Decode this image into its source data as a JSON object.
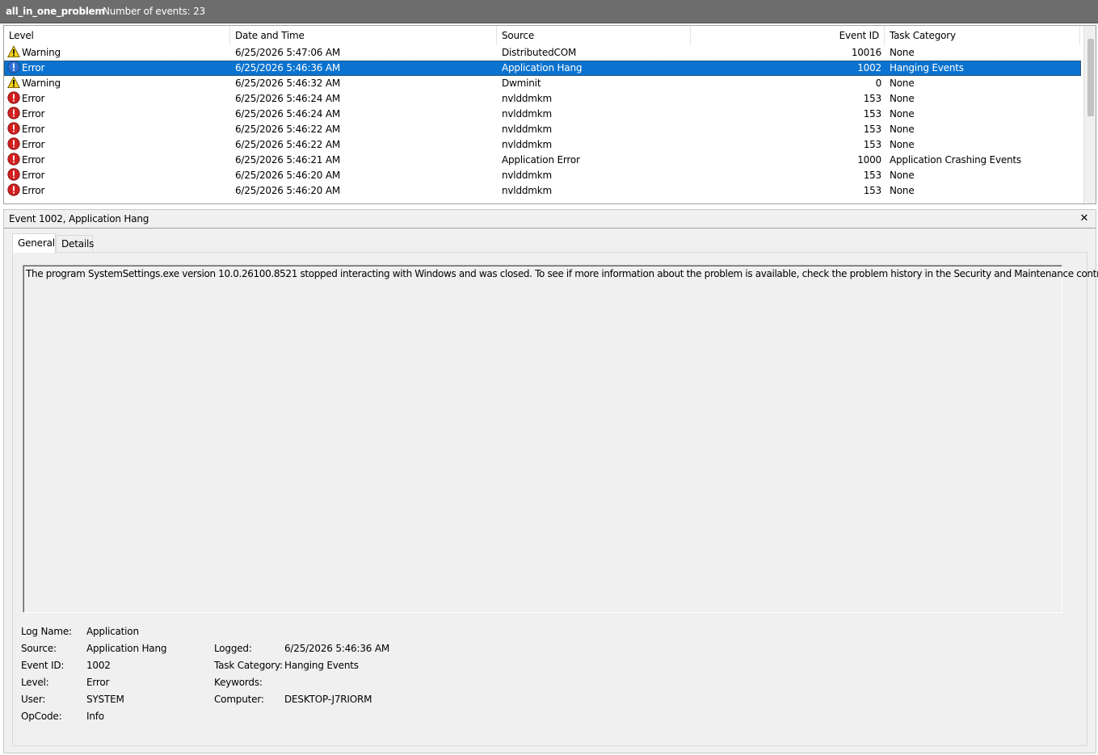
{
  "header": {
    "title": "all_in_one_problem",
    "count": "Number of events: 23"
  },
  "columns": {
    "level": "Level",
    "date_time": "Date and Time",
    "source": "Source",
    "event_id": "Event ID",
    "task_category": "Task Category"
  },
  "rows": [
    {
      "level": "Warning",
      "icon": "warning-icon",
      "date_time": "6/25/2026 5:47:06 AM",
      "source": "DistributedCOM",
      "event_id": "10016",
      "task_category": "None",
      "selected": false
    },
    {
      "level": "Error",
      "icon": "error-icon",
      "date_time": "6/25/2026 5:46:36 AM",
      "source": "Application Hang",
      "event_id": "1002",
      "task_category": "Hanging Events",
      "selected": true
    },
    {
      "level": "Warning",
      "icon": "warning-icon",
      "date_time": "6/25/2026 5:46:32 AM",
      "source": "Dwminit",
      "event_id": "0",
      "task_category": "None",
      "selected": false
    },
    {
      "level": "Error",
      "icon": "error-icon",
      "date_time": "6/25/2026 5:46:24 AM",
      "source": "nvlddmkm",
      "event_id": "153",
      "task_category": "None",
      "selected": false
    },
    {
      "level": "Error",
      "icon": "error-icon",
      "date_time": "6/25/2026 5:46:24 AM",
      "source": "nvlddmkm",
      "event_id": "153",
      "task_category": "None",
      "selected": false
    },
    {
      "level": "Error",
      "icon": "error-icon",
      "date_time": "6/25/2026 5:46:22 AM",
      "source": "nvlddmkm",
      "event_id": "153",
      "task_category": "None",
      "selected": false
    },
    {
      "level": "Error",
      "icon": "error-icon",
      "date_time": "6/25/2026 5:46:22 AM",
      "source": "nvlddmkm",
      "event_id": "153",
      "task_category": "None",
      "selected": false
    },
    {
      "level": "Error",
      "icon": "error-icon",
      "date_time": "6/25/2026 5:46:21 AM",
      "source": "Application Error",
      "event_id": "1000",
      "task_category": "Application Crashing Events",
      "selected": false
    },
    {
      "level": "Error",
      "icon": "error-icon",
      "date_time": "6/25/2026 5:46:20 AM",
      "source": "nvlddmkm",
      "event_id": "153",
      "task_category": "None",
      "selected": false
    },
    {
      "level": "Error",
      "icon": "error-icon",
      "date_time": "6/25/2026 5:46:20 AM",
      "source": "nvlddmkm",
      "event_id": "153",
      "task_category": "None",
      "selected": false
    }
  ],
  "detail": {
    "title": "Event 1002, Application Hang",
    "close_icon": "close-icon",
    "tabs": [
      "General",
      "Details"
    ],
    "active_tab": "General",
    "description": "The program SystemSettings.exe version 10.0.26100.8521 stopped interacting with Windows and was closed. To see if more information about the problem is available, check the problem history in the Security and Maintenance control panel.",
    "props": {
      "log_name_label": "Log Name:",
      "log_name": "Application",
      "source_label": "Source:",
      "source": "Application Hang",
      "logged_label": "Logged:",
      "logged": "6/25/2026 5:46:36 AM",
      "event_id_label": "Event ID:",
      "event_id": "1002",
      "task_category_label": "Task Category:",
      "task_category": "Hanging Events",
      "level_label": "Level:",
      "level": "Error",
      "keywords_label": "Keywords:",
      "keywords": "",
      "user_label": "User:",
      "user": "SYSTEM",
      "computer_label": "Computer:",
      "computer": "DESKTOP-J7RIORM",
      "opcode_label": "OpCode:",
      "opcode": "Info"
    }
  },
  "colors": {
    "header_bg": "#6d6d6d",
    "selection": "#0a73cf",
    "error_red": "#d21f1f",
    "warning_yellow": "#f5d21a",
    "info_blue": "#2f6fd0"
  }
}
